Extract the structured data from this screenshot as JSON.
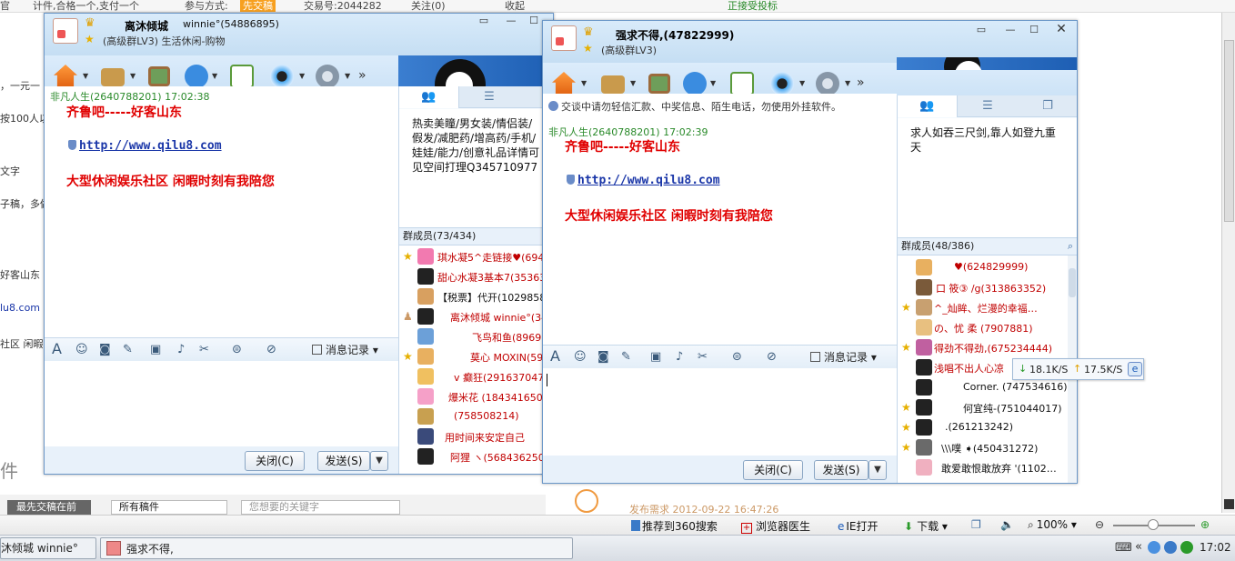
{
  "background_page": {
    "top_items": [
      "官",
      "计件,合格一个,支付一个",
      "参与方式:",
      "先交稿",
      "交易号:2044282",
      "关注(0)",
      "收起",
      "正接受投标"
    ],
    "left_fragments": [
      "，一元一",
      "按100人以上",
      "文字",
      "子稿，多做",
      "好客山东",
      "lu8.com",
      "社区 闲暇"
    ],
    "bottom_word": "件",
    "sort_button": "最先交稿在前",
    "filter_select": "所有稿件",
    "search_placeholder": "您想要的关键字",
    "publish_text": "发布需求  2012-09-22 16:47:26"
  },
  "window1": {
    "group_name": "离沐倾城",
    "owner": "winnie°(54886895)",
    "group_level": "(高级群LV3) 生活休闲-购物",
    "chat": {
      "sender": "非凡人生(2640788201)   17:02:38",
      "line1": "齐鲁吧-----好客山东",
      "link": "http://www.qilu8.com",
      "line3": "大型休闲娱乐社区 闲暇时刻有我陪您"
    },
    "history_label": "消息记录",
    "close_label": "关闭(C)",
    "send_label": "发送(S)",
    "announcement": "热卖美瞳/男女装/情侣装/假发/减肥药/增高药/手机/娃娃/能力/创意礼品详情可见空间打理Q345710977",
    "members_header": "群成员(73/434)",
    "members": [
      {
        "name": "琪水凝5^走链接♥(694",
        "star": true
      },
      {
        "name": "甜心水凝3基本7(35363",
        "star": false
      },
      {
        "name": "【税票】代开(10298580",
        "star": false
      },
      {
        "name": "离沐倾城   winnie°(34",
        "star": false,
        "owner": true
      },
      {
        "name": "飞鸟和鱼(89698",
        "star": false
      },
      {
        "name": "莫心 MOXIN(594",
        "star": true
      },
      {
        "name": "v 癫狂(291637047)",
        "star": false
      },
      {
        "name": "爆米花 (184341650)",
        "star": false
      },
      {
        "name": "(758508214)",
        "star": false
      },
      {
        "name": "用时间来安定自己",
        "star": false
      },
      {
        "name": "阿狸 ヽ(568436250)",
        "star": false
      }
    ]
  },
  "window2": {
    "group_name": "强求不得,(47822999)",
    "group_level": "(高级群LV3)",
    "notice": "交谈中请勿轻信汇款、中奖信息、陌生电话，勿使用外挂软件。",
    "chat": {
      "sender": "非凡人生(2640788201)   17:02:39",
      "line1": "齐鲁吧-----好客山东",
      "link": "http://www.qilu8.com",
      "line3": "大型休闲娱乐社区 闲暇时刻有我陪您"
    },
    "history_label": "消息记录",
    "close_label": "关闭(C)",
    "send_label": "发送(S)",
    "announcement": "求人如吞三尺剑,靠人如登九重天",
    "members_header": "群成员(48/386)",
    "members": [
      {
        "name": "♥(624829999)",
        "star": false
      },
      {
        "name": "口  筱③  /g(313863352)",
        "star": false
      },
      {
        "name": "^_灿眸、烂漫的幸福…",
        "star": true
      },
      {
        "name": "の、忧 柔 (7907881)",
        "star": false
      },
      {
        "name": "得劲不得劲,(675234444)",
        "star": true
      },
      {
        "name": "浅唱不出人心凉",
        "star": false
      },
      {
        "name": "Corner. (747534616)",
        "star": false
      },
      {
        "name": "何宜纯-(751044017)",
        "star": true
      },
      {
        "name": ".(261213242)",
        "star": true
      },
      {
        "name": "\\\\\\噗 ➧(450431272)",
        "star": true
      },
      {
        "name": "敢爱敢恨敢放弃 '(1102…",
        "star": false
      }
    ]
  },
  "tooltip": {
    "down": "18.1K/S",
    "up": "17.5K/S"
  },
  "statusbar": {
    "items": [
      "推荐到360搜索",
      "浏览器医生",
      "IE打开",
      "下载"
    ],
    "zoom": "100%"
  },
  "taskbar": {
    "tasks": [
      "沐倾城  winnie°",
      "强求不得,"
    ],
    "clock": "17:02"
  },
  "colors": {
    "accent": "#e00000",
    "link": "#1a36a8",
    "sender": "#2a8a2a",
    "window_border": "#6b97c8"
  }
}
